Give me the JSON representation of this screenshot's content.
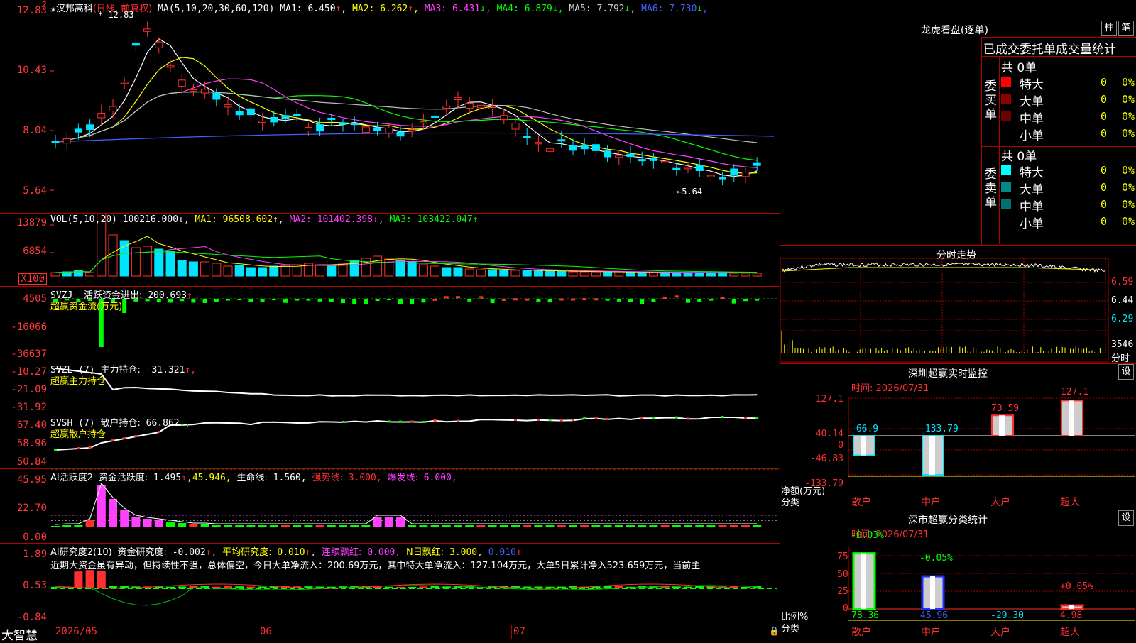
{
  "stock_name": "汉邦高科",
  "mode": "(日线, 前复权)",
  "star": "★",
  "corner_mark": "?",
  "price_panel": {
    "ma_label": "MA(5,10,20,30,60,120)",
    "ma": [
      {
        "name": "MA1",
        "value": "6.450",
        "arrow": "↑",
        "color": "#ffffff"
      },
      {
        "name": "MA2",
        "value": "6.262",
        "arrow": "↑",
        "color": "#ffff00"
      },
      {
        "name": "MA3",
        "value": "6.431",
        "arrow": "↓",
        "color": "#ff40ff"
      },
      {
        "name": "MA4",
        "value": "6.879",
        "arrow": "↓",
        "color": "#00ff00"
      },
      {
        "name": "MA5",
        "value": "7.792",
        "arrow": "↓",
        "color": "#cccccc"
      },
      {
        "name": "MA6",
        "value": "7.730",
        "arrow": "↓",
        "color": "#4060ff"
      }
    ],
    "y_labels": [
      "12.83",
      "10.43",
      "8.04",
      "5.64"
    ],
    "high_note": "12.83",
    "low_note": "←5.64"
  },
  "vol_panel": {
    "label": "VOL(5,10,20)",
    "value": "100216.000↓",
    "ma": [
      {
        "name": "MA1",
        "value": "96508.602↑",
        "color": "#ffff00"
      },
      {
        "name": "MA2",
        "value": "101402.398↓",
        "color": "#ff40ff"
      },
      {
        "name": "MA3",
        "value": "103422.047↑",
        "color": "#00ff00"
      }
    ],
    "y_labels": [
      "13879",
      "6854"
    ],
    "unit": "X100"
  },
  "svzj_panel": {
    "label": "SVZJ",
    "item": "活跃资金进出:",
    "value": "200.693",
    "arrow": "↑,",
    "subtitle": "超赢资金流(万元)",
    "y_labels": [
      "4505",
      "-16066",
      "-36637"
    ]
  },
  "svzl_panel": {
    "label": "SVZL (7)",
    "item": "主力持仓:",
    "value": "-31.321",
    "arrow": "↑,",
    "subtitle": "超赢主力持仓",
    "y_labels": [
      "-10.27",
      "-21.09",
      "-31.92"
    ]
  },
  "svsh_panel": {
    "label": "SVSH (7)",
    "item": "散户持仓:",
    "value": "66.862",
    "arrow": "↓,",
    "subtitle": "超赢散户持仓",
    "y_labels": [
      "67.40",
      "58.96",
      "50.84"
    ]
  },
  "ai_act_panel": {
    "label": "AI活跃度2",
    "item1": "资金活跃度:",
    "v1": "1.495",
    "v1b": "45.946,",
    "item2": "生命线:",
    "v2": "1.560,",
    "item3": "强势线:",
    "v3": "3.000,",
    "item4": "爆发线:",
    "v4": "6.000,",
    "y_labels": [
      "45.95",
      "22.70",
      "0.00"
    ]
  },
  "ai_res_panel": {
    "label": "AI研究度2(10)",
    "item1": "资金研究度:",
    "v1": "-0.002",
    "item2": "平均研究度:",
    "v2": "0.010",
    "item3": "连续飘红:",
    "v3": "0.000,",
    "item4": "N日飘红:",
    "v4": "3.000,",
    "v5": "0.010",
    "comment": "近期大资金虽有异动，但持续性不强，总体偏空，今日大单净流入：200.69万元，其中特大单净流入：127.104万元，大单5日累计净入523.659万元，当前主",
    "y_labels": [
      "1.89",
      "0.53",
      "-0.84"
    ]
  },
  "x_axis": {
    "brand": "大智慧",
    "labels": [
      "2026/05",
      "06",
      "07"
    ]
  },
  "lhb": {
    "title": "龙虎看盘(逐单)",
    "btn1": "柱",
    "btn2": "笔",
    "subtitle": "已成交委托单成交量统计",
    "buy_label": "委买单",
    "sell_label": "委卖单",
    "buy_total": "共 0单",
    "sell_total": "共 0单",
    "buy_rows": [
      {
        "name": "特大",
        "count": "0",
        "pct": "0%",
        "color": "#ff0000"
      },
      {
        "name": "大单",
        "count": "0",
        "pct": "0%",
        "color": "#8b0000"
      },
      {
        "name": "中单",
        "count": "0",
        "pct": "0%",
        "color": "#6a0000"
      },
      {
        "name": "小单",
        "count": "0",
        "pct": "0%",
        "color": ""
      }
    ],
    "sell_rows": [
      {
        "name": "特大",
        "count": "0",
        "pct": "0%",
        "color": "#00ffff"
      },
      {
        "name": "大单",
        "count": "0",
        "pct": "0%",
        "color": "#008b8b"
      },
      {
        "name": "中单",
        "count": "0",
        "pct": "0%",
        "color": "#007070"
      },
      {
        "name": "小单",
        "count": "0",
        "pct": "0%",
        "color": ""
      }
    ]
  },
  "intraday": {
    "title": "分时走势",
    "y_labels": [
      "6.59",
      "6.44",
      "6.29"
    ],
    "vol_label": "3546",
    "unit": "分时"
  },
  "sz_monitor": {
    "title": "深圳超赢实时监控",
    "btn": "设",
    "time": "时间: 2026/07/31",
    "y_labels": [
      "127.1",
      "40.14",
      "0",
      "-46.83",
      "-133.79"
    ],
    "net_label": "净额(万元)",
    "cat_label": "分类",
    "bars": [
      {
        "name": "散户",
        "value": "-66.9",
        "label_color": "#00e5ff"
      },
      {
        "name": "中户",
        "value": "-133.79",
        "label_color": "#00e5ff"
      },
      {
        "name": "大户",
        "value": "73.59",
        "label_color": "#ff3030"
      },
      {
        "name": "超大",
        "value": "127.1",
        "label_color": "#ff3030"
      }
    ]
  },
  "sz_class": {
    "title": "深市超赢分类统计",
    "btn": "设",
    "time": "时间: 2026/07/31",
    "y_labels": [
      "75",
      "50",
      "25",
      "0"
    ],
    "ratio_label": "比例%",
    "cat_label": "分类",
    "bars": [
      {
        "name": "散户",
        "pct": "-0.03%",
        "value": "78.36",
        "pct_color": "#00ff00",
        "val_color": "#00ff00"
      },
      {
        "name": "中户",
        "pct": "-0.05%",
        "value": "45.96",
        "pct_color": "#00ff00",
        "val_color": "#4060ff"
      },
      {
        "name": "大户",
        "pct": "",
        "value": "-29.30",
        "pct_color": "#00ff00",
        "val_color": "#00e5ff"
      },
      {
        "name": "超大",
        "pct": "+0.05%",
        "value": "4.98",
        "pct_color": "#ff3030",
        "val_color": "#ff3030"
      }
    ]
  }
}
